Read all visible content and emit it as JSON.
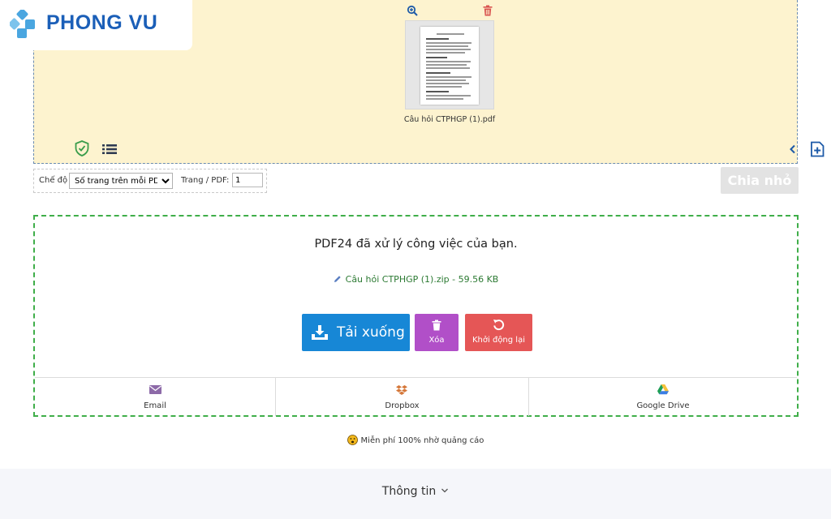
{
  "brand": {
    "name": "PHONG VU",
    "color": "#1b5fb8",
    "mark_color": "#4aa6e0"
  },
  "file_area": {
    "file_name": "Câu hỏi CTPHGP (1).pdf",
    "icons": [
      "zoom-in-icon",
      "trash-icon",
      "shield-check-icon",
      "list-icon",
      "chevron-left-icon",
      "add-file-icon"
    ]
  },
  "options": {
    "mode_label": "Chế độ",
    "mode_value": "Số trang trên mỗi PDF",
    "pages_label": "Trang / PDF:",
    "pages_value": "1",
    "split_button": "Chia nhỏ"
  },
  "result": {
    "title": "PDF24 đã xử lý công việc của bạn.",
    "file": "Câu hỏi CTPHGP (1).zip - 59.56 KB",
    "download_label": "Tải xuống",
    "delete_label": "Xóa",
    "restart_label": "Khởi động lại",
    "colors": {
      "download": "#1787d6",
      "delete": "#b14fc8",
      "restart": "#e55656",
      "border": "#3fae49"
    },
    "share": [
      {
        "label": "Email",
        "icon": "envelope-icon"
      },
      {
        "label": "Dropbox",
        "icon": "dropbox-icon"
      },
      {
        "label": "Google Drive",
        "icon": "google-drive-icon"
      }
    ]
  },
  "free_note": "Miễn phí 100% nhờ quảng cáo",
  "footer": {
    "label": "Thông tin"
  }
}
